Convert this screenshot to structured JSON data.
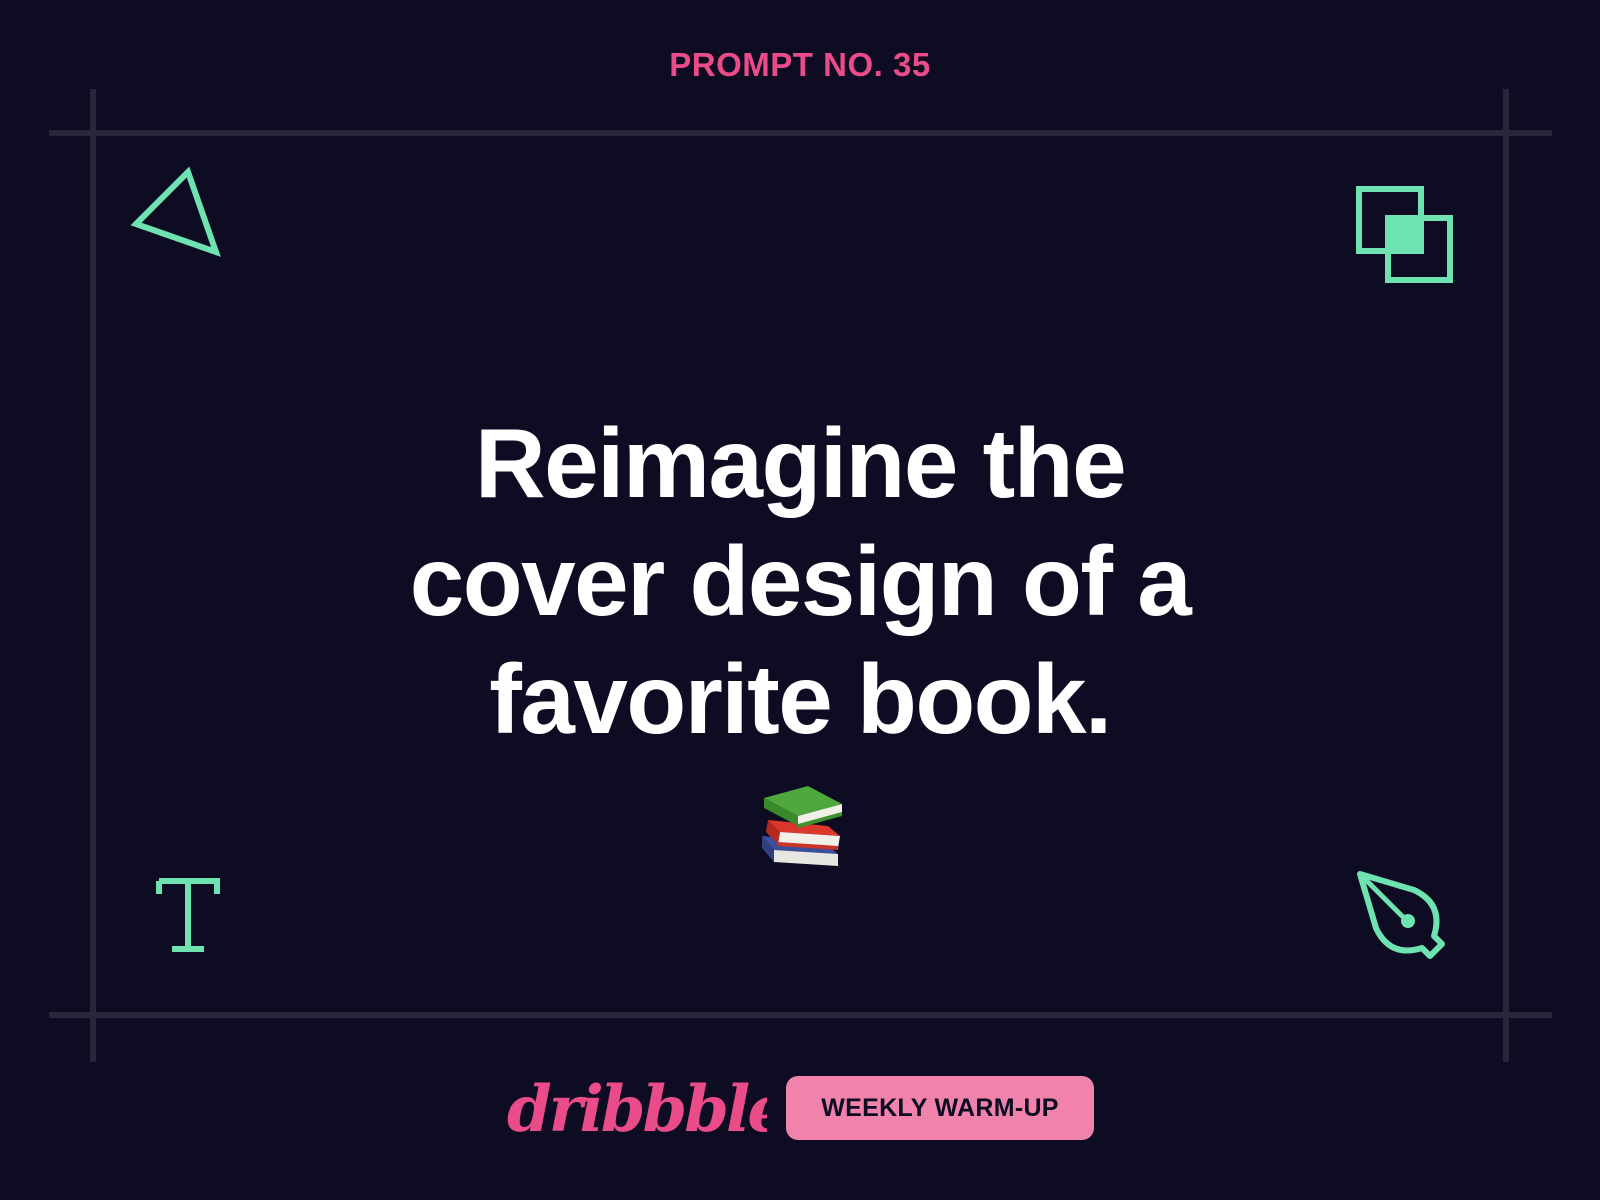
{
  "prompt_label": "PROMPT NO. 35",
  "headline": {
    "line1": "Reimagine the",
    "line2": "cover design of a",
    "line3": "favorite book."
  },
  "emoji": "books-stack",
  "corner_icons": {
    "top_left": "cursor-arrow-icon",
    "top_right": "layers-overlap-icon",
    "bottom_left": "text-tool-icon",
    "bottom_right": "pen-tool-icon"
  },
  "footer": {
    "logo_text": "dribbble",
    "badge_label": "WEEKLY WARM-UP"
  },
  "colors": {
    "background": "#0d0c22",
    "frame": "#27263a",
    "pink": "#ea4c89",
    "badge_pink": "#f082ac",
    "green": "#6ee2b0",
    "white": "#ffffff"
  }
}
